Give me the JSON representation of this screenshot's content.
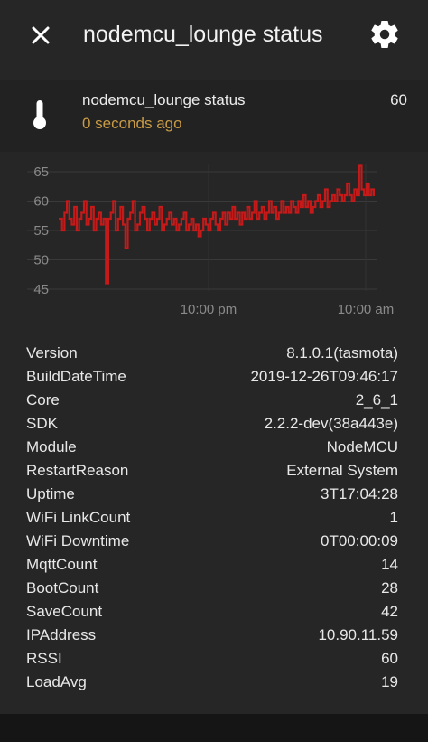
{
  "header": {
    "title": "nodemcu_lounge status"
  },
  "entity": {
    "name": "nodemcu_lounge status",
    "last_changed": "0 seconds ago",
    "state": "60"
  },
  "colors": {
    "accent_time": "#c99b45",
    "series": "#c41a1a"
  },
  "chart_data": {
    "type": "line",
    "y_ticks": [
      "65",
      "60",
      "55",
      "50",
      "45"
    ],
    "x_ticks": [
      "10:00 pm",
      "10:00 am"
    ],
    "ylim": [
      45,
      65
    ],
    "grid": true,
    "series": [
      {
        "values": [
          57,
          55,
          58,
          60,
          57,
          56,
          59,
          55,
          57,
          58,
          60,
          56,
          57,
          59,
          55,
          57,
          58,
          56,
          57,
          46,
          57,
          58,
          60,
          55,
          57,
          59,
          56,
          52,
          57,
          58,
          60,
          55,
          56,
          58,
          59,
          57,
          55,
          57,
          58,
          56,
          57,
          59,
          55,
          56,
          57,
          58,
          56,
          57,
          55,
          56,
          57,
          58,
          55,
          56,
          57,
          55,
          56,
          54,
          55,
          57,
          56,
          55,
          57,
          58,
          56,
          55,
          57,
          58,
          56,
          58,
          57,
          59,
          57,
          58,
          56,
          58,
          57,
          59,
          57,
          58,
          60,
          57,
          58,
          59,
          57,
          58,
          60,
          58,
          59,
          57,
          58,
          60,
          58,
          59,
          58,
          60,
          59,
          58,
          60,
          59,
          61,
          59,
          60,
          58,
          59,
          60,
          61,
          59,
          60,
          62,
          59,
          60,
          61,
          60,
          62,
          61,
          60,
          61,
          63,
          61,
          60,
          62,
          61,
          66,
          62,
          61,
          63,
          61,
          62,
          61
        ]
      }
    ]
  },
  "attributes": [
    {
      "key": "Version",
      "value": "8.1.0.1(tasmota)"
    },
    {
      "key": "BuildDateTime",
      "value": "2019-12-26T09:46:17"
    },
    {
      "key": "Core",
      "value": "2_6_1"
    },
    {
      "key": "SDK",
      "value": "2.2.2-dev(38a443e)"
    },
    {
      "key": "Module",
      "value": "NodeMCU"
    },
    {
      "key": "RestartReason",
      "value": "External System"
    },
    {
      "key": "Uptime",
      "value": "3T17:04:28"
    },
    {
      "key": "WiFi LinkCount",
      "value": "1"
    },
    {
      "key": "WiFi Downtime",
      "value": "0T00:00:09"
    },
    {
      "key": "MqttCount",
      "value": "14"
    },
    {
      "key": "BootCount",
      "value": "28"
    },
    {
      "key": "SaveCount",
      "value": "42"
    },
    {
      "key": "IPAddress",
      "value": "10.90.11.59"
    },
    {
      "key": "RSSI",
      "value": "60"
    },
    {
      "key": "LoadAvg",
      "value": "19"
    }
  ]
}
